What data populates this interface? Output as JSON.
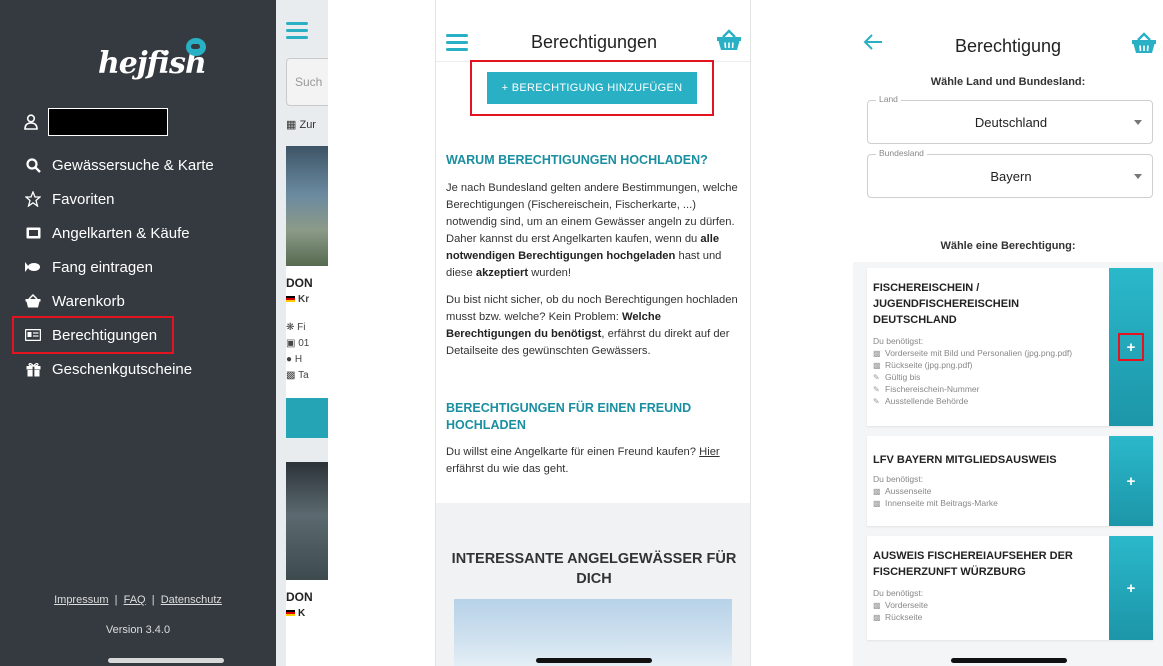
{
  "panel_menu": {
    "logo_text": "hejfish",
    "items": [
      {
        "label": "Gewässersuche & Karte",
        "icon": "search-icon"
      },
      {
        "label": "Favoriten",
        "icon": "star-icon"
      },
      {
        "label": "Angelkarten & Käufe",
        "icon": "card-icon"
      },
      {
        "label": "Fang eintragen",
        "icon": "fish-icon"
      },
      {
        "label": "Warenkorb",
        "icon": "basket-icon"
      },
      {
        "label": "Berechtigungen",
        "icon": "id-card-icon",
        "active": true
      },
      {
        "label": "Geschenkgutscheine",
        "icon": "gift-icon"
      }
    ],
    "footer_links": [
      "Impressum",
      "FAQ",
      "Datenschutz"
    ],
    "version": "Version 3.4.0",
    "behind": {
      "search_placeholder": "Such",
      "zur": "Zur",
      "card_title": "DON",
      "card_sub": "Kr",
      "rows": [
        "Fi",
        "01",
        "H",
        "Ta"
      ],
      "card2_title": "DON",
      "card2_sub": "K"
    }
  },
  "panel_berechtigungen": {
    "title": "Berechtigungen",
    "add_button": "+ BERECHTIGUNG HINZUFÜGEN",
    "section1_title": "WARUM BERECHTIGUNGEN HOCHLADEN?",
    "section1_p1_a": "Je nach Bundesland gelten andere Bestimmungen, welche Berechtigungen (Fischereischein, Fischerkarte, ...) notwendig sind, um an einem Gewässer angeln zu dürfen. Daher kannst du erst Angelkarten kaufen, wenn du ",
    "section1_p1_b": "alle notwendigen Berechtigungen hochgeladen",
    "section1_p1_c": " hast und diese ",
    "section1_p1_d": "akzeptiert",
    "section1_p1_e": " wurden!",
    "section1_p2_a": "Du bist nicht sicher, ob du noch Berechtigungen hochladen musst bzw. welche? Kein Problem: ",
    "section1_p2_b": "Welche Berechtigungen du benötigst",
    "section1_p2_c": ", erfährst du direkt auf der Detailseite des gewünschten Gewässers.",
    "section2_title": "BERECHTIGUNGEN FÜR EINEN FREUND HOCHLADEN",
    "section2_p_a": "Du willst eine Angelkarte für einen Freund kaufen? ",
    "section2_p_link": "Hier",
    "section2_p_b": " erfährst du wie das geht.",
    "promo_title": "INTERESSANTE ANGELGEWÄSSER FÜR DICH"
  },
  "panel_berechtigung": {
    "title": "Berechtigung",
    "choose_country_label": "Wähle Land und Bundesland:",
    "land_label": "Land",
    "land_value": "Deutschland",
    "bundesland_label": "Bundesland",
    "bundesland_value": "Bayern",
    "choose_perm_label": "Wähle eine Berechtigung:",
    "permissions": [
      {
        "title": "FISCHEREISCHEIN / JUGENDFISCHEREISCHEIN DEUTSCHLAND",
        "need_label": "Du benötigst:",
        "requirements": [
          {
            "icon": "file-icon",
            "text": "Vorderseite mit Bild und Personalien (jpg.png.pdf)"
          },
          {
            "icon": "file-icon",
            "text": "Rückseite (jpg.png.pdf)"
          },
          {
            "icon": "edit-icon",
            "text": "Gültig bis"
          },
          {
            "icon": "edit-icon",
            "text": "Fischereischein-Nummer"
          },
          {
            "icon": "edit-icon",
            "text": "Ausstellende Behörde"
          }
        ],
        "plus": "+"
      },
      {
        "title": "LFV BAYERN MITGLIEDSAUSWEIS",
        "need_label": "Du benötigst:",
        "requirements": [
          {
            "icon": "file-icon",
            "text": "Aussenseite"
          },
          {
            "icon": "file-icon",
            "text": "Innenseite mit Beitrags-Marke"
          }
        ],
        "plus": "+"
      },
      {
        "title": "AUSWEIS FISCHEREIAUFSEHER DER FISCHERZUNFT WÜRZBURG",
        "need_label": "Du benötigst:",
        "requirements": [
          {
            "icon": "file-icon",
            "text": "Vorderseite"
          },
          {
            "icon": "file-icon",
            "text": "Rückseite"
          }
        ],
        "plus": "+"
      }
    ]
  },
  "colors": {
    "accent": "#2ab0c5",
    "heading_teal": "#1a8fa1",
    "highlight_red": "#e3131f",
    "menu_bg": "#343a40"
  }
}
